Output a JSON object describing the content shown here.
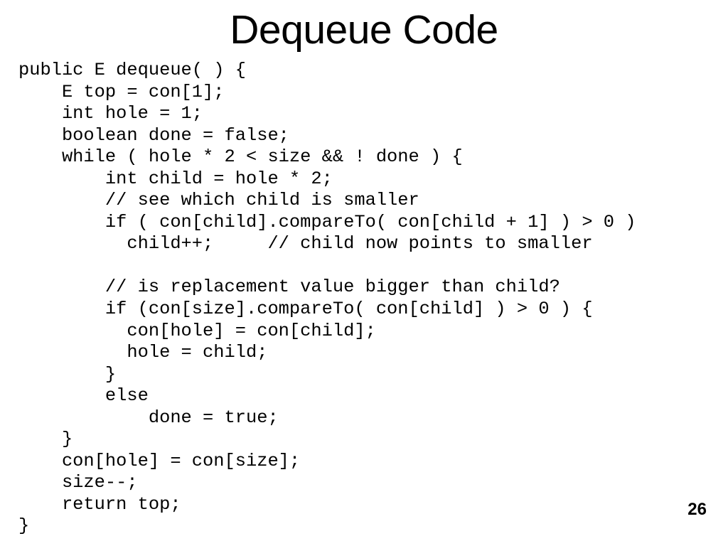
{
  "slide": {
    "title": "Dequeue Code",
    "page_number": "26",
    "background_color": "#ffffff",
    "text_color": "#000000",
    "code_lines": [
      "public E dequeue( ) {",
      "    E top = con[1];",
      "    int hole = 1;",
      "    boolean done = false;",
      "    while ( hole * 2 < size && ! done ) {",
      "        int child = hole * 2;",
      "        // see which child is smaller",
      "        if ( con[child].compareTo( con[child + 1] ) > 0 )",
      "          child++;     // child now points to smaller",
      "",
      "        // is replacement value bigger than child?",
      "        if (con[size].compareTo( con[child] ) > 0 ) {",
      "          con[hole] = con[child];",
      "          hole = child;",
      "        }",
      "        else",
      "            done = true;",
      "    }",
      "    con[hole] = con[size];",
      "    size--;",
      "    return top;",
      "}"
    ]
  }
}
